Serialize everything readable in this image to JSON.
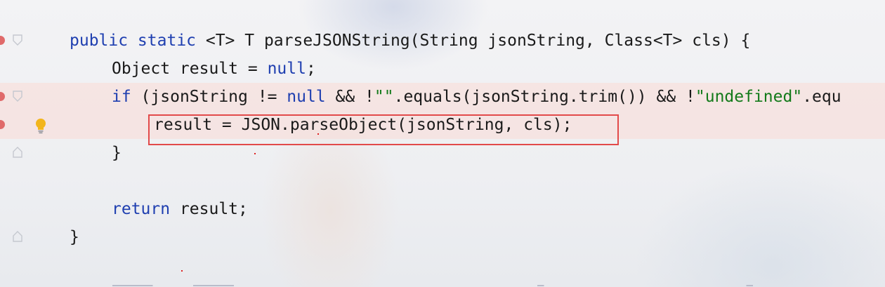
{
  "editor": {
    "language": "java",
    "keyword_color": "#1f3fb0",
    "string_color": "#137a1a",
    "highlight_box_color": "#e24a4a",
    "lines": [
      {
        "kw1": "public static",
        "rest": " <T> T parseJSONString(String jsonString, Class<T> cls) {"
      },
      {
        "p1": "Object result = ",
        "kw": "null",
        "p2": ";"
      },
      {
        "kw1": "if",
        "p1": " (jsonString != ",
        "kw2": "null",
        "p2": " && !",
        "s1": "\"\"",
        "p3": ".equals(jsonString.trim()) && !",
        "s2": "\"undefined\"",
        "p4": ".equ"
      },
      {
        "text": "result = JSON.parseObject(jsonString, cls);"
      },
      {
        "text": "}"
      },
      {
        "text": ""
      },
      {
        "kw": "return",
        "p1": " result;"
      },
      {
        "text": "}"
      }
    ]
  },
  "gutter": {
    "breakpoint_lines": [
      1,
      3,
      4
    ],
    "fold_icons": [
      "fold-arrow-icon",
      "fold-arrow-icon",
      "fold-end-icon",
      "fold-end-icon"
    ],
    "intention_icon": "lightbulb-icon"
  }
}
